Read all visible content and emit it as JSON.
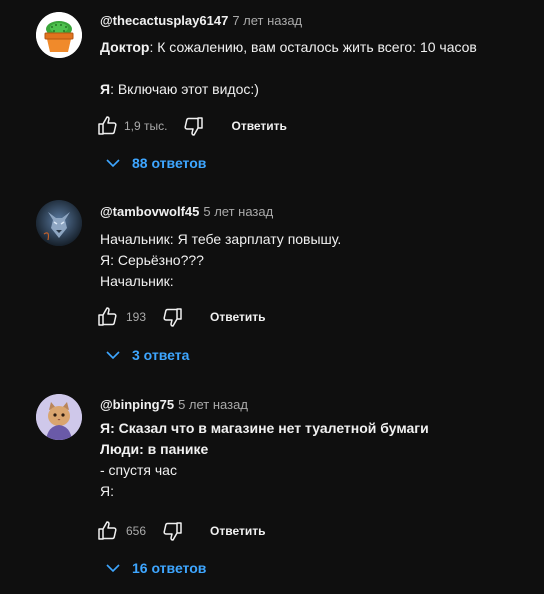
{
  "colors": {
    "background": "#0f0f0f",
    "text": "#f1f1f1",
    "muted": "#aaaaaa",
    "link": "#3ea6ff"
  },
  "comments": [
    {
      "author": "@thecactusplay6147",
      "time": "7 лет назад",
      "lines": [
        {
          "label": "Доктор",
          "text": ": К сожалению, вам осталось жить всего: 10 часов"
        },
        {
          "label": "",
          "text": ""
        },
        {
          "label": "Я",
          "text": ": Включаю этот видос:)"
        }
      ],
      "likes": "1,9 тыс.",
      "reply_label": "Ответить",
      "replies_label": "88 ответов",
      "avatar_icon": "cactus-in-pot-avatar"
    },
    {
      "author": "@tambovwolf45",
      "time": "5 лет назад",
      "lines": [
        {
          "label": "",
          "text": "Начальник: Я тебе зарплату повышу."
        },
        {
          "label": "",
          "text": "Я: Серьёзно???"
        },
        {
          "label": "",
          "text": "Начальник:"
        }
      ],
      "likes": "193",
      "reply_label": "Ответить",
      "replies_label": "3 ответа",
      "avatar_icon": "wolf-avatar"
    },
    {
      "author": "@binping75",
      "time": "5 лет назад",
      "lines": [
        {
          "label": "",
          "text": "Я: Сказал что в магазине нет туалетной бумаги"
        },
        {
          "label": "",
          "text": "Люди: в панике"
        },
        {
          "label": "",
          "text": "- спустя час"
        },
        {
          "label": "",
          "text": "Я:"
        }
      ],
      "likes": "656",
      "reply_label": "Ответить",
      "replies_label": "16 ответов",
      "avatar_icon": "cat-avatar"
    }
  ]
}
